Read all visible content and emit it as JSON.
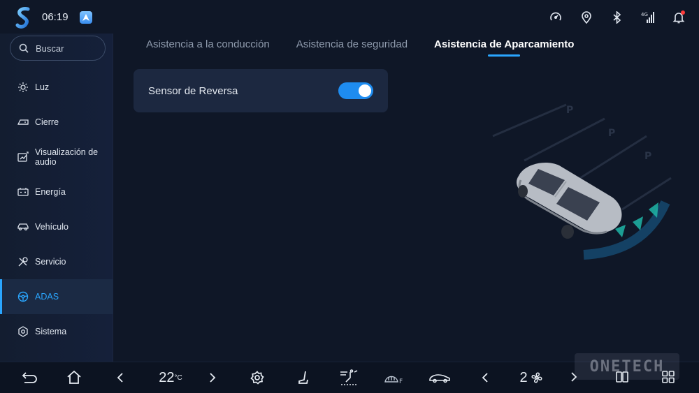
{
  "status": {
    "time": "06:19",
    "icons": [
      "speed-gauge-icon",
      "location-pin-icon",
      "bluetooth-icon",
      "4g-signal-icon",
      "notification-bell-icon"
    ],
    "network_label": "4G",
    "accent_color": "#2aa6ff"
  },
  "sidebar": {
    "search_placeholder": "Buscar",
    "items": [
      {
        "label": "Luz",
        "icon": "sun-icon"
      },
      {
        "label": "Cierre",
        "icon": "door-icon"
      },
      {
        "label": "Visualización de audio",
        "icon": "audio-visual-icon"
      },
      {
        "label": "Energía",
        "icon": "battery-icon"
      },
      {
        "label": "Vehículo",
        "icon": "car-icon"
      },
      {
        "label": "Servicio",
        "icon": "wrench-icon"
      },
      {
        "label": "ADAS",
        "icon": "steering-wheel-icon",
        "active": true
      },
      {
        "label": "Sistema",
        "icon": "gear-icon"
      }
    ]
  },
  "tabs": [
    {
      "label": "Asistencia a la conducción"
    },
    {
      "label": "Asistencia de seguridad"
    },
    {
      "label": "Asistencia de Aparcamiento",
      "active": true
    }
  ],
  "settings": {
    "reverse_sensor_label": "Sensor de Reversa",
    "reverse_sensor_on": true
  },
  "dock": {
    "temperature": "22",
    "temperature_unit": "°C",
    "fan_speed": "2",
    "rear_defrost_label": "F"
  },
  "watermark": "ONETECH"
}
